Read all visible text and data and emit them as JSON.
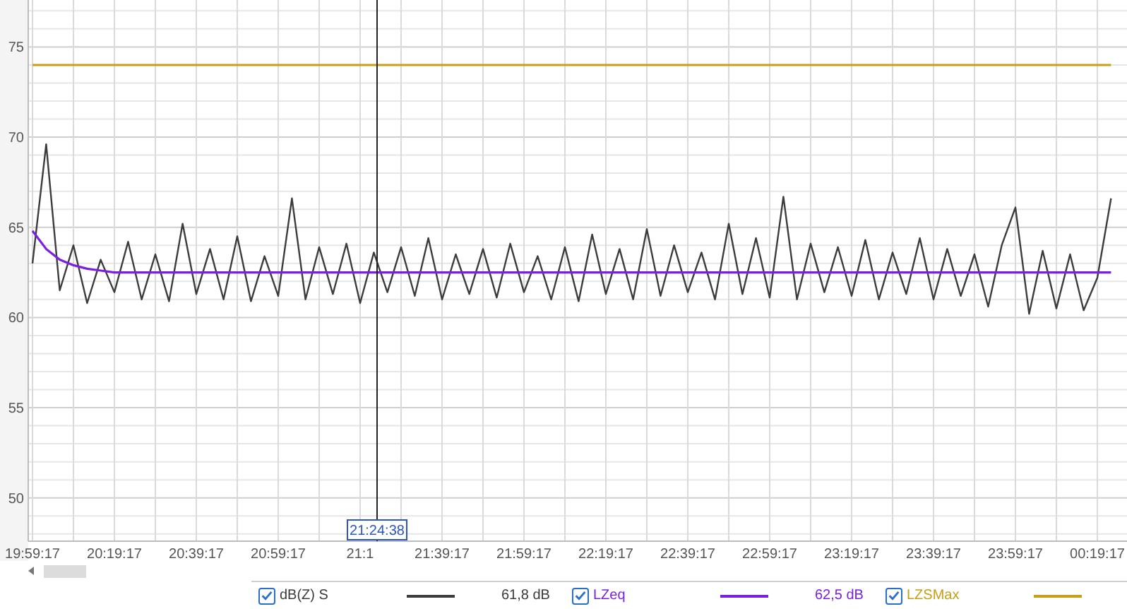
{
  "chart_data": {
    "type": "line",
    "categories": [
      "19:59:17",
      null,
      null,
      null,
      null,
      null,
      "20:19:17",
      null,
      null,
      null,
      null,
      null,
      "20:39:17",
      null,
      null,
      null,
      null,
      null,
      "20:59:17",
      null,
      null,
      null,
      null,
      null,
      "21:1",
      null,
      null,
      null,
      null,
      null,
      "21:39:17",
      null,
      null,
      null,
      null,
      null,
      "21:59:17",
      null,
      null,
      null,
      null,
      null,
      "22:19:17",
      null,
      null,
      null,
      null,
      null,
      "22:39:17",
      null,
      null,
      null,
      null,
      null,
      "22:59:17",
      null,
      null,
      null,
      null,
      null,
      "23:19:17",
      null,
      null,
      null,
      null,
      null,
      "23:39:17",
      null,
      null,
      null,
      null,
      null,
      "23:59:17",
      null,
      null,
      null,
      null,
      null,
      "00:19:17",
      null
    ],
    "ylim": [
      47.6,
      77.6
    ],
    "yticks": [
      50,
      55,
      60,
      65,
      70,
      75
    ],
    "series": [
      {
        "name": "dB(Z) S",
        "color": "#3c3c3c",
        "values": [
          63,
          69.6,
          61.5,
          64,
          60.8,
          63.2,
          61.4,
          64.2,
          61,
          63.5,
          60.9,
          65.2,
          61.3,
          63.8,
          61,
          64.5,
          60.9,
          63.4,
          61.2,
          66.6,
          61,
          63.9,
          61.3,
          64.1,
          60.8,
          63.6,
          61.4,
          63.9,
          61.2,
          64.4,
          61,
          63.5,
          61.3,
          63.8,
          61.1,
          64.1,
          61.4,
          63.4,
          61,
          63.9,
          60.9,
          64.6,
          61.3,
          63.8,
          61,
          64.9,
          61.2,
          64,
          61.4,
          63.6,
          61,
          65.2,
          61.3,
          64.4,
          61.1,
          66.7,
          61,
          64.1,
          61.4,
          63.9,
          61.2,
          64.3,
          61,
          63.6,
          61.3,
          64.4,
          61,
          63.8,
          61.2,
          63.5,
          60.6,
          64,
          66.1,
          60.2,
          63.7,
          60.5,
          63.5,
          60.4,
          62.2,
          66.6
        ]
      },
      {
        "name": "LZeq",
        "color": "#7b1fe0",
        "values": [
          64.8,
          63.8,
          63.2,
          62.9,
          62.7,
          62.6,
          62.5,
          62.5,
          62.5,
          62.5,
          62.5,
          62.5,
          62.5,
          62.5,
          62.5,
          62.5,
          62.5,
          62.5,
          62.5,
          62.5,
          62.5,
          62.5,
          62.5,
          62.5,
          62.5,
          62.5,
          62.5,
          62.5,
          62.5,
          62.5,
          62.5,
          62.5,
          62.5,
          62.5,
          62.5,
          62.5,
          62.5,
          62.5,
          62.5,
          62.5,
          62.5,
          62.5,
          62.5,
          62.5,
          62.5,
          62.5,
          62.5,
          62.5,
          62.5,
          62.5,
          62.5,
          62.5,
          62.5,
          62.5,
          62.5,
          62.5,
          62.5,
          62.5,
          62.5,
          62.5,
          62.5,
          62.5,
          62.5,
          62.5,
          62.5,
          62.5,
          62.5,
          62.5,
          62.5,
          62.5,
          62.5,
          62.5,
          62.5,
          62.5,
          62.5,
          62.5,
          62.5,
          62.5,
          62.5,
          62.5
        ]
      },
      {
        "name": "LZSMax",
        "color": "#c8a018",
        "values": [
          74,
          74,
          74,
          74,
          74,
          74,
          74,
          74,
          74,
          74,
          74,
          74,
          74,
          74,
          74,
          74,
          74,
          74,
          74,
          74,
          74,
          74,
          74,
          74,
          74,
          74,
          74,
          74,
          74,
          74,
          74,
          74,
          74,
          74,
          74,
          74,
          74,
          74,
          74,
          74,
          74,
          74,
          74,
          74,
          74,
          74,
          74,
          74,
          74,
          74,
          74,
          74,
          74,
          74,
          74,
          74,
          74,
          74,
          74,
          74,
          74,
          74,
          74,
          74,
          74,
          74,
          74,
          74,
          74,
          74,
          74,
          74,
          74,
          74,
          74,
          74,
          74,
          74,
          74,
          74
        ]
      }
    ],
    "annotations": [
      "21:24:38"
    ],
    "grid": true
  },
  "legend": [
    {
      "checked": true,
      "reading": "61,8 dB"
    },
    {
      "checked": true,
      "reading": "62,5 dB"
    },
    {
      "checked": true
    }
  ]
}
